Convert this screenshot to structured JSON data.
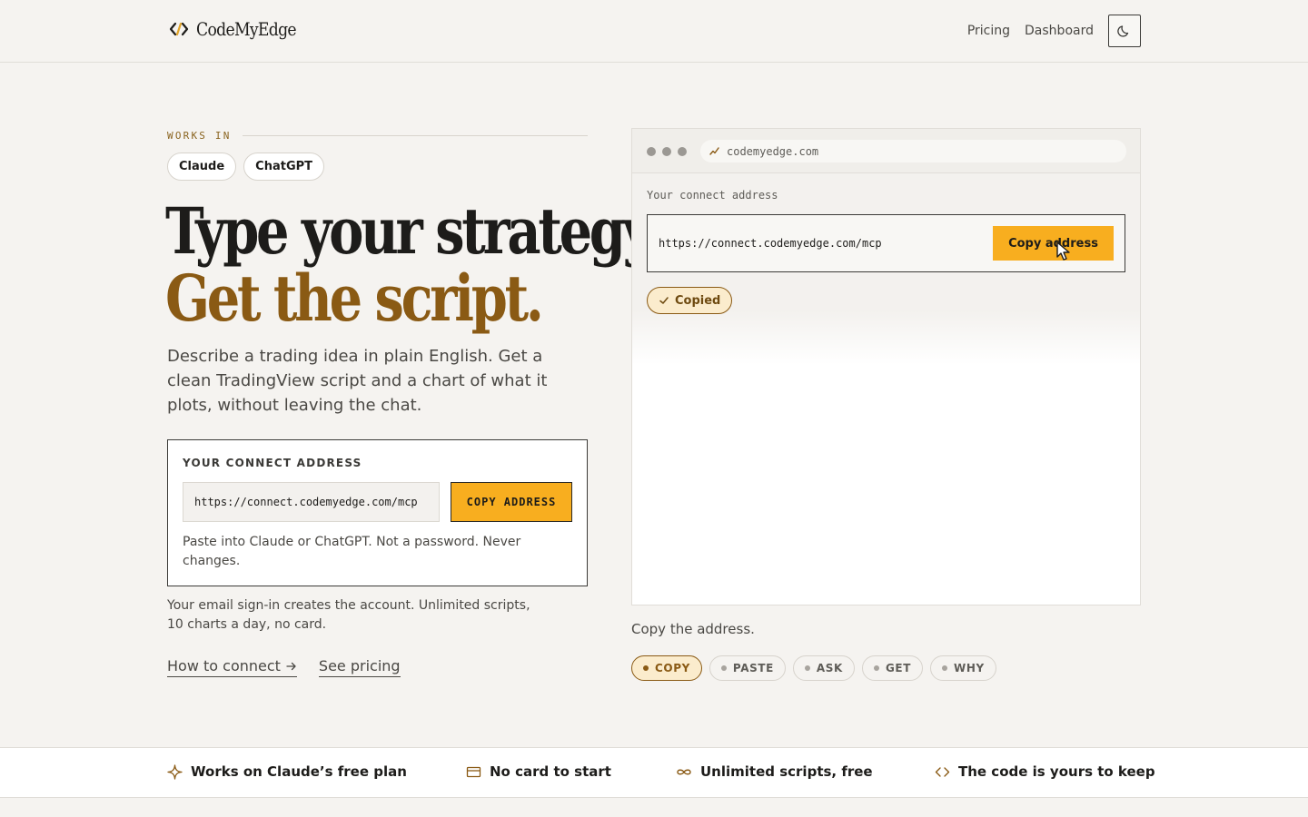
{
  "header": {
    "logo_text": "CodeMyEdge",
    "nav": {
      "pricing": "Pricing",
      "dashboard": "Dashboard"
    },
    "theme_icon": "moon-icon"
  },
  "hero": {
    "works_in_label": "WORKS IN",
    "chips": [
      "Claude",
      "ChatGPT"
    ],
    "headline_line1": "Type your strategy.",
    "headline_line2": "Get the script.",
    "lede": "Describe a trading idea in plain English. Get a clean TradingView script and a chart of what it plots, without leaving the chat."
  },
  "connect_card": {
    "title": "YOUR CONNECT ADDRESS",
    "address": "https://connect.codemyedge.com/mcp",
    "copy_label": "COPY ADDRESS",
    "hint": "Paste into Claude or ChatGPT. Not a password. Never changes."
  },
  "signin_note": "Your email sign-in creates the account. Unlimited scripts, 10 charts a day, no card.",
  "links": {
    "how_to_connect": "How to connect",
    "see_pricing": "See pricing"
  },
  "browser_demo": {
    "url": "codemyedge.com",
    "label": "Your connect address",
    "address": "https://connect.codemyedge.com/mcp",
    "copy_label": "Copy address",
    "copied_label": "Copied"
  },
  "demo_caption": "Copy the address.",
  "steps": [
    {
      "label": "COPY",
      "active": true
    },
    {
      "label": "PASTE",
      "active": false
    },
    {
      "label": "ASK",
      "active": false
    },
    {
      "label": "GET",
      "active": false
    },
    {
      "label": "WHY",
      "active": false
    }
  ],
  "features": [
    {
      "icon": "sparkle-icon",
      "label": "Works on Claude’s free plan"
    },
    {
      "icon": "card-icon",
      "label": "No card to start"
    },
    {
      "icon": "infinity-icon",
      "label": "Unlimited scripts, free"
    },
    {
      "icon": "code-icon",
      "label": "The code is yours to keep"
    }
  ],
  "colors": {
    "accent": "#f8ae1f",
    "brand_brown": "#8a5a14",
    "background": "#f5f3f0"
  }
}
